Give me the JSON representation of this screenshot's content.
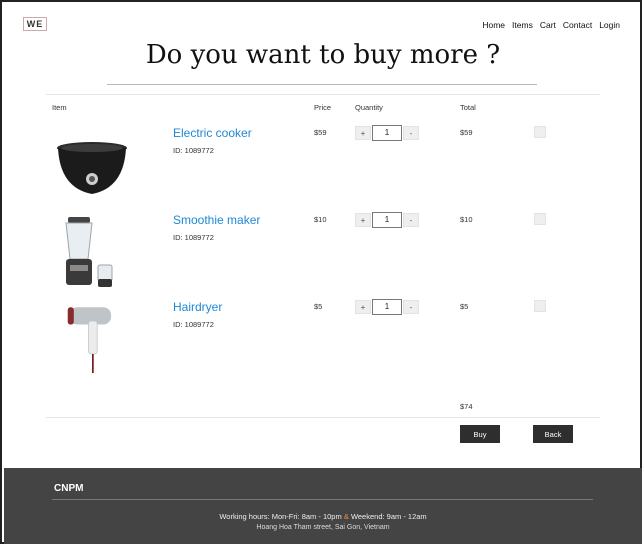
{
  "brand": {
    "logo_text": "WE"
  },
  "nav": [
    "Home",
    "Items",
    "Cart",
    "Contact",
    "Login"
  ],
  "page_title": "Do you want to buy more ?",
  "table": {
    "headers": {
      "item": "Item",
      "price": "Price",
      "quantity": "Quantity",
      "total": "Total"
    },
    "rows": [
      {
        "name": "Electric cooker",
        "id_text": "ID: 1089772",
        "price": "$59",
        "quantity": "1",
        "total": "$59",
        "image_icon": "rice-cooker-icon"
      },
      {
        "name": "Smoothie maker",
        "id_text": "ID: 1089772",
        "price": "$10",
        "quantity": "1",
        "total": "$10",
        "image_icon": "blender-icon"
      },
      {
        "name": "Hairdryer",
        "id_text": "ID: 1089772",
        "price": "$5",
        "quantity": "1",
        "total": "$5",
        "image_icon": "hairdryer-icon"
      }
    ],
    "qty_minus_label": "-",
    "qty_plus_label": "+",
    "grand_total": "$74"
  },
  "actions": {
    "buy_label": "Buy",
    "back_label": "Back"
  },
  "footer": {
    "brand": "CNPM",
    "hours_weekday": "Working hours: Mon-Fri: 8am - 10pm",
    "hours_sep": "&",
    "hours_weekend": "Weekend: 9am - 12am",
    "address": "Hoang Hoa Tham street, Sai Gon, Vietnam"
  },
  "colors": {
    "link": "#1e88d6",
    "footer_bg": "#444444",
    "button_bg": "#2e2e2e",
    "accent": "#e8913a"
  }
}
